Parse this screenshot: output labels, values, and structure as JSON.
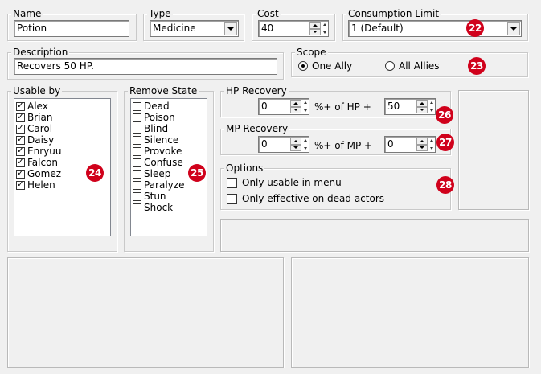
{
  "name": {
    "label": "Name",
    "value": "Potion"
  },
  "type": {
    "label": "Type",
    "value": "Medicine"
  },
  "cost": {
    "label": "Cost",
    "value": "40"
  },
  "consumption": {
    "label": "Consumption Limit",
    "value": "1 (Default)"
  },
  "description": {
    "label": "Description",
    "value": "Recovers 50 HP."
  },
  "scope": {
    "label": "Scope",
    "options": [
      "One Ally",
      "All Allies"
    ],
    "selected": "One Ally"
  },
  "usable_by": {
    "label": "Usable by",
    "items": [
      {
        "name": "Alex",
        "checked": true
      },
      {
        "name": "Brian",
        "checked": true
      },
      {
        "name": "Carol",
        "checked": true
      },
      {
        "name": "Daisy",
        "checked": true
      },
      {
        "name": "Enryuu",
        "checked": true
      },
      {
        "name": "Falcon",
        "checked": true
      },
      {
        "name": "Gomez",
        "checked": true
      },
      {
        "name": "Helen",
        "checked": true
      }
    ]
  },
  "remove_state": {
    "label": "Remove State",
    "items": [
      {
        "name": "Dead",
        "checked": false
      },
      {
        "name": "Poison",
        "checked": false
      },
      {
        "name": "Blind",
        "checked": false
      },
      {
        "name": "Silence",
        "checked": false
      },
      {
        "name": "Provoke",
        "checked": false
      },
      {
        "name": "Confuse",
        "checked": false
      },
      {
        "name": "Sleep",
        "checked": false
      },
      {
        "name": "Paralyze",
        "checked": false
      },
      {
        "name": "Stun",
        "checked": false
      },
      {
        "name": "Shock",
        "checked": false
      }
    ]
  },
  "hp_recovery": {
    "label": "HP Recovery",
    "percent": "0",
    "mid_label": "%+ of HP +",
    "flat": "50"
  },
  "mp_recovery": {
    "label": "MP Recovery",
    "percent": "0",
    "mid_label": "%+ of MP +",
    "flat": "0"
  },
  "options": {
    "label": "Options",
    "items": [
      {
        "name": "Only usable in menu",
        "checked": false
      },
      {
        "name": "Only effective on dead actors",
        "checked": false
      }
    ]
  },
  "badges": [
    "22",
    "23",
    "24",
    "25",
    "26",
    "27",
    "28"
  ],
  "colors": {
    "badge": "#d0011b",
    "background": "#f0f0f0"
  }
}
